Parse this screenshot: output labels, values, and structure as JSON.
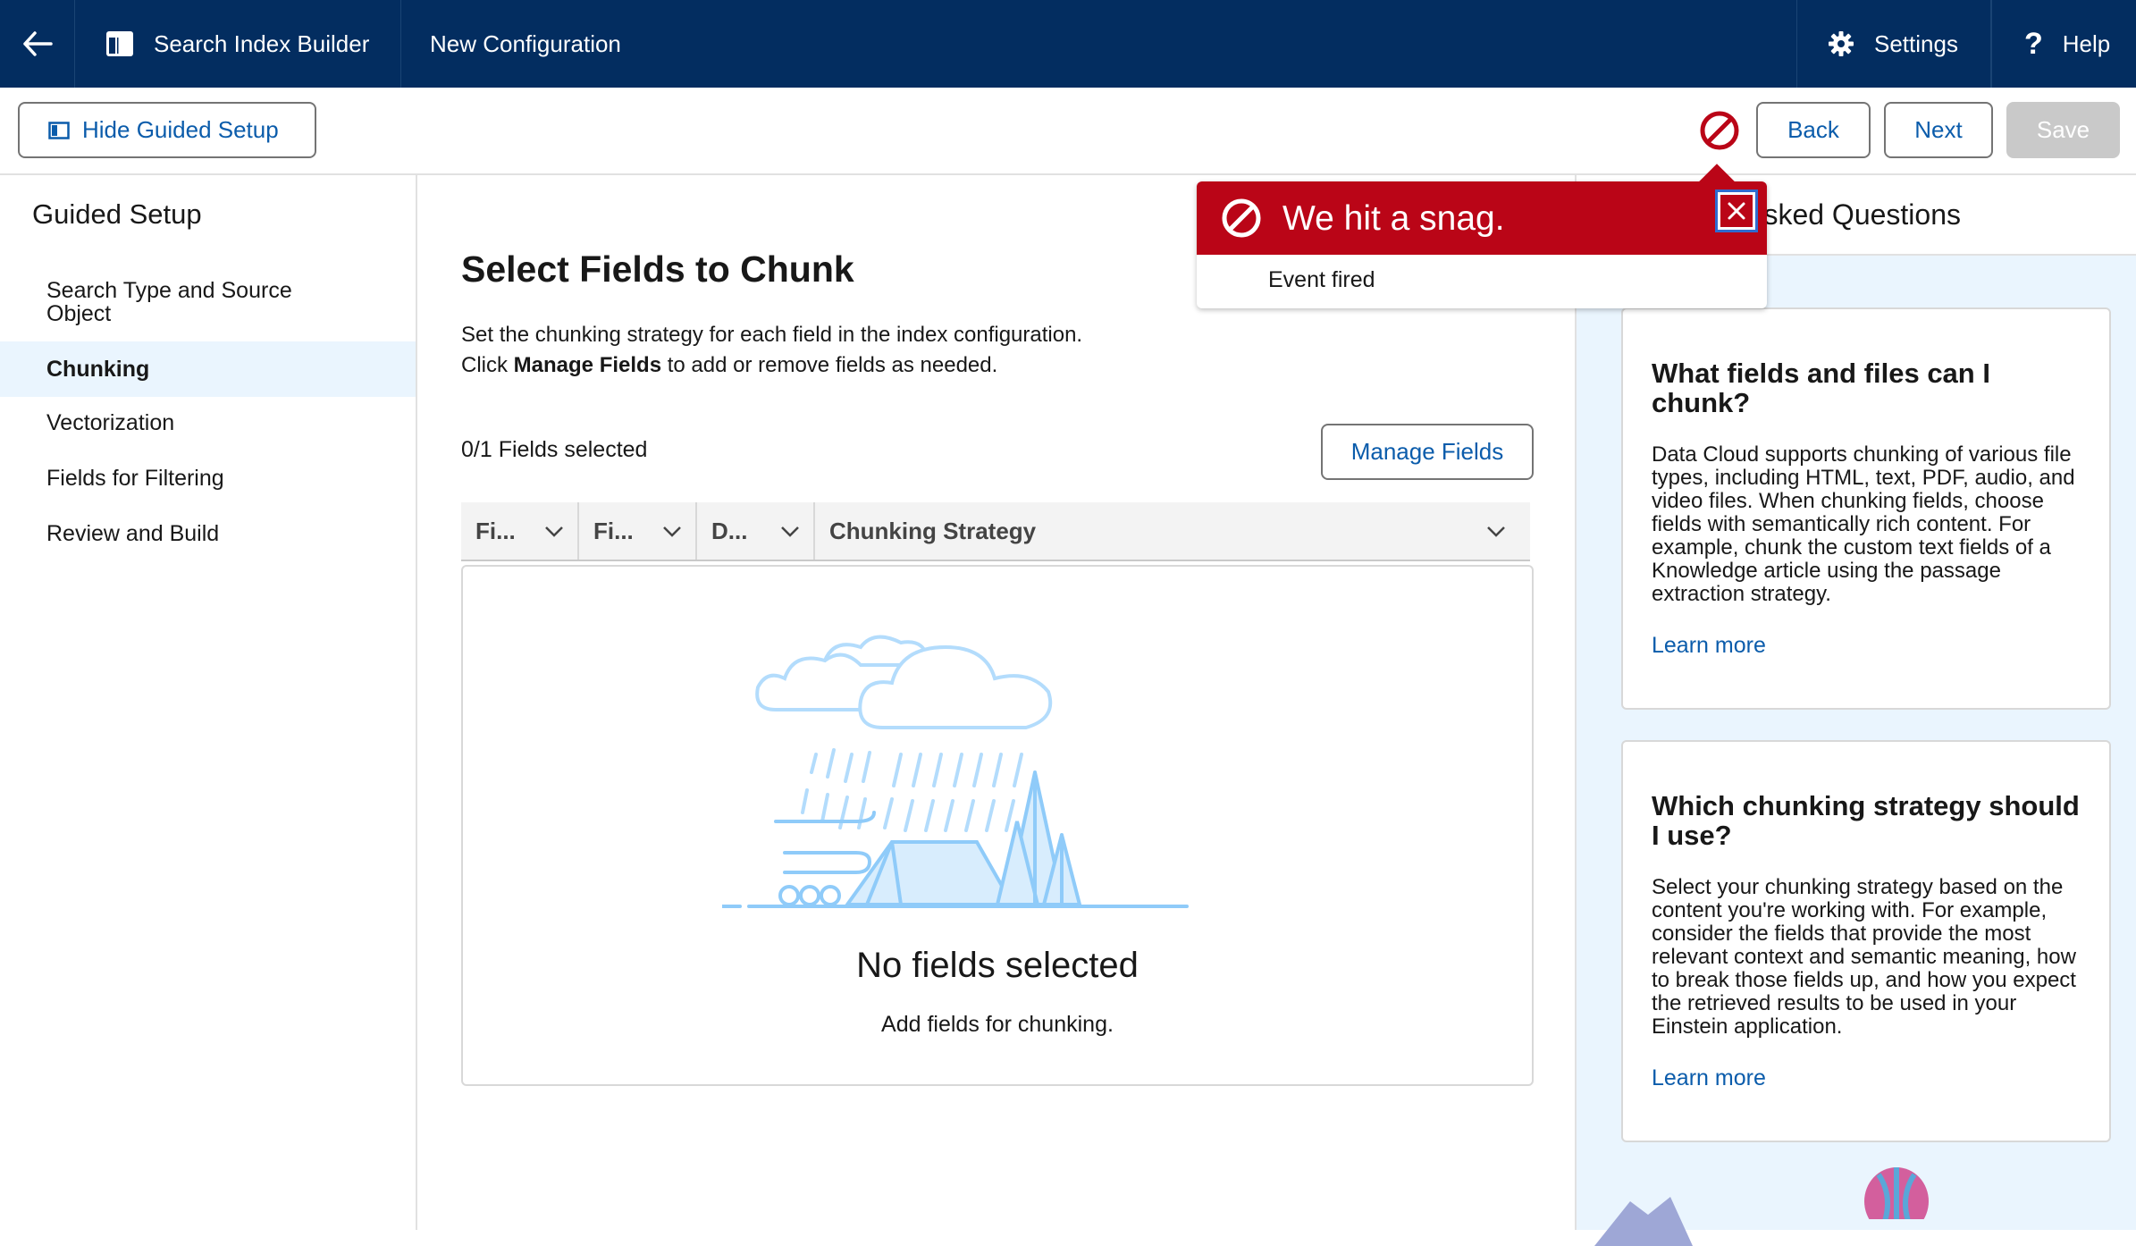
{
  "topbar": {
    "app_title": "Search Index Builder",
    "config_title": "New Configuration",
    "settings_label": "Settings",
    "help_label": "Help"
  },
  "toolbar": {
    "hide_guided_label": "Hide Guided Setup",
    "back_label": "Back",
    "next_label": "Next",
    "save_label": "Save"
  },
  "sidebar": {
    "title": "Guided Setup",
    "items": [
      {
        "label": "Search Type and Source Object",
        "active": false
      },
      {
        "label": "Chunking",
        "active": true
      },
      {
        "label": "Vectorization",
        "active": false
      },
      {
        "label": "Fields for Filtering",
        "active": false
      },
      {
        "label": "Review and Build",
        "active": false
      }
    ]
  },
  "main": {
    "title": "Select Fields to Chunk",
    "desc_line1": "Set the chunking strategy for each field in the index configuration.",
    "desc_line2_pre": "Click ",
    "desc_line2_bold": "Manage Fields",
    "desc_line2_post": " to add or remove fields as needed.",
    "count": "0/1 Fields selected",
    "manage_label": "Manage Fields",
    "columns": [
      "Fi...",
      "Fi...",
      "D...",
      "Chunking Strategy"
    ],
    "empty_title": "No fields selected",
    "empty_sub": "Add fields for chunking."
  },
  "right": {
    "faq_title": "Frequently Asked Questions",
    "cards": [
      {
        "title": "What fields and files can I chunk?",
        "body": "Data Cloud supports chunking of various file types, including HTML, text, PDF, audio, and video files. When chunking fields, choose fields with semantically rich content. For example, chunk the custom text fields of a Knowledge article using the passage extraction strategy.",
        "link": "Learn more"
      },
      {
        "title": "Which chunking strategy should I use?",
        "body": "Select your chunking strategy based on the content you're working with. For example, consider the fields that provide the most relevant context and semantic meaning, how to break those fields up, and how you expect the retrieved results to be used in your Einstein application.",
        "link": "Learn more"
      }
    ]
  },
  "error": {
    "title": "We hit a snag.",
    "message": "Event fired"
  },
  "colors": {
    "nav_bg": "#032d60",
    "brand_link": "#0b5cab",
    "error": "#ba0517",
    "active_nav_bg": "#eaf5fe"
  }
}
